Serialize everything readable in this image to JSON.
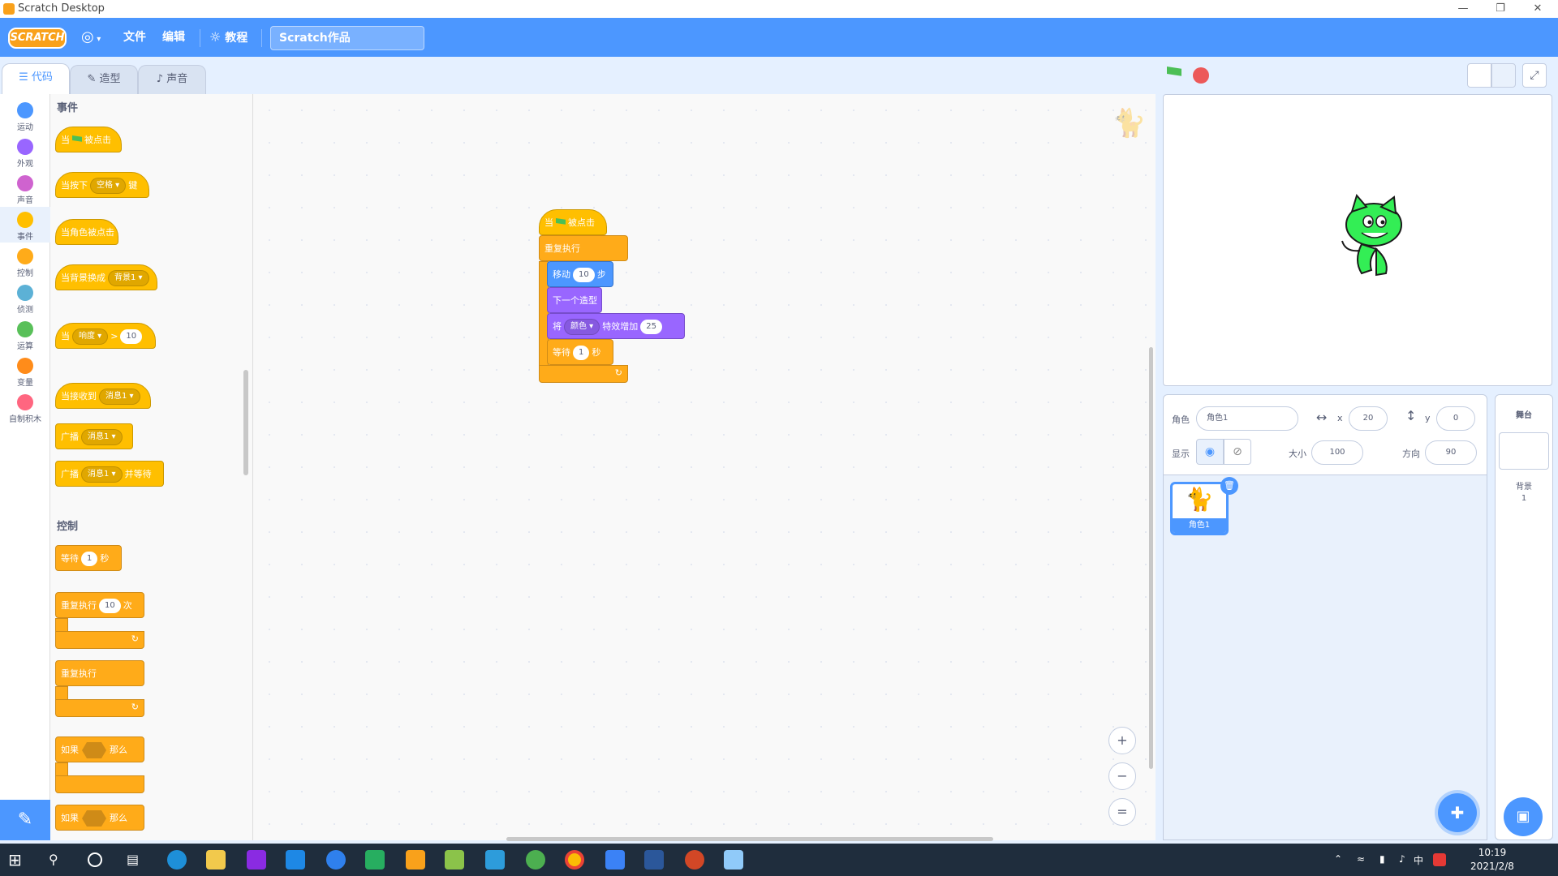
{
  "window": {
    "title": "Scratch Desktop",
    "controls": {
      "minimize": "—",
      "maximize": "❐",
      "close": "✕"
    }
  },
  "menubar": {
    "logo": "SCRATCH",
    "language_icon": "globe-icon",
    "file": "文件",
    "edit": "编辑",
    "tutorials": "教程",
    "project_title": "Scratch作品"
  },
  "tabs": {
    "code": "代码",
    "costumes": "造型",
    "sounds": "声音"
  },
  "categories": [
    {
      "label": "运动",
      "color": "#4c97ff"
    },
    {
      "label": "外观",
      "color": "#9966ff"
    },
    {
      "label": "声音",
      "color": "#cf63cf"
    },
    {
      "label": "事件",
      "color": "#ffbf00"
    },
    {
      "label": "控制",
      "color": "#ffab19"
    },
    {
      "label": "侦测",
      "color": "#5cb1d6"
    },
    {
      "label": "运算",
      "color": "#59c059"
    },
    {
      "label": "变量",
      "color": "#ff8c1a"
    },
    {
      "label": "自制积木",
      "color": "#ff6680"
    }
  ],
  "palette": {
    "events_title": "事件",
    "control_title": "控制",
    "when": "当",
    "clicked": "被点击",
    "when_key_pressed": "当按下",
    "key_space": "空格",
    "key_suffix": "键",
    "when_sprite_clicked": "当角色被点击",
    "when_backdrop_switches": "当背景换成",
    "backdrop1": "背景1",
    "when_loudness_prefix": "当",
    "loudness": "响度",
    "gt": ">",
    "loudness_value": "10",
    "when_receive": "当接收到",
    "message1": "消息1",
    "broadcast": "广播",
    "broadcast_wait_suffix": "并等待",
    "wait": "等待",
    "wait_value": "1",
    "seconds": "秒",
    "repeat": "重复执行",
    "repeat_times": "10",
    "times": "次",
    "forever": "重复执行",
    "if": "如果",
    "then": "那么"
  },
  "script": {
    "when": "当",
    "clicked": "被点击",
    "forever": "重复执行",
    "move": "移动",
    "move_steps": "10",
    "steps": "步",
    "next_costume": "下一个造型",
    "change": "将",
    "effect": "颜色",
    "effect_by": "特效增加",
    "effect_value": "25",
    "wait": "等待",
    "wait_value": "1",
    "seconds": "秒"
  },
  "zoom": {
    "in": "+",
    "out": "−",
    "reset": "="
  },
  "sprite_info": {
    "sprite_label": "角色",
    "sprite_name": "角色1",
    "x_label": "x",
    "x_value": "20",
    "y_label": "y",
    "y_value": "0",
    "show_label": "显示",
    "size_label": "大小",
    "size_value": "100",
    "direction_label": "方向",
    "direction_value": "90"
  },
  "sprite_list": [
    {
      "name": "角色1"
    }
  ],
  "stage_pane": {
    "title": "舞台",
    "backdrops_label": "背景",
    "backdrops_count": "1"
  },
  "taskbar": {
    "time": "10:19",
    "date": "2021/2/8",
    "ime": "中"
  }
}
